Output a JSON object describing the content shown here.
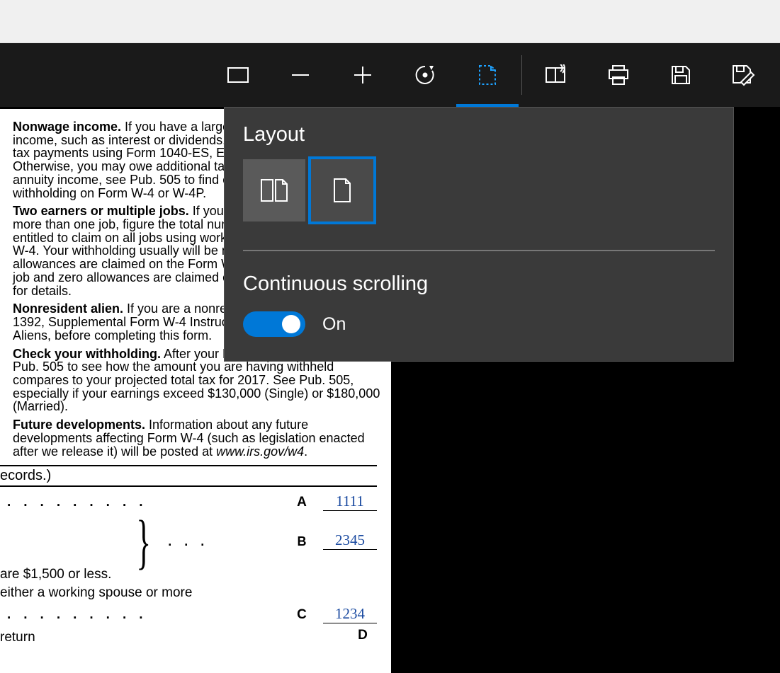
{
  "toolbar": {
    "icons": {
      "fit": "fit-width-icon",
      "zoom_out": "zoom-out-icon",
      "zoom_in": "zoom-in-icon",
      "rotate": "rotate-icon",
      "layout": "layout-icon",
      "read_aloud": "read-aloud-icon",
      "print": "print-icon",
      "save": "save-icon",
      "save_as": "save-as-icon"
    }
  },
  "layout_popup": {
    "title": "Layout",
    "options": {
      "two_page": "two-page-layout",
      "single_page": "single-page-layout",
      "selected": "single_page"
    },
    "continuous_title": "Continuous scrolling",
    "toggle_state": "On"
  },
  "document": {
    "paragraphs": {
      "nonwage": {
        "heading": "Nonwage income.",
        "body": " If you have a large amount of nonwage income, such as interest or dividends, consider making estimated tax payments using Form 1040-ES, Estimated Tax for Individuals. Otherwise, you may owe additional tax. If you have pension or annuity income, see Pub. 505 to find out if you should adjust your withholding on Form W-4 or W-4P."
      },
      "two_earners": {
        "heading": "Two earners or multiple jobs.",
        "body": " If you have a working spouse or more than one job, figure the total number of allowances you are entitled to claim on all jobs using worksheets from only one Form W-4. Your withholding usually will be most accurate when all allowances are claimed on the Form W-4 for the highest paying job and zero allowances are claimed on the others. See Pub. 505 for details."
      },
      "nonresident": {
        "heading": "Nonresident alien.",
        "body": " If you are a nonresident alien, see Notice 1392, Supplemental Form W-4 Instructions for Nonresident Aliens, before completing this form."
      },
      "check": {
        "heading": "Check your withholding.",
        "body": " After your Form W-4 takes effect, use Pub. 505 to see how the amount you are having withheld compares to your projected total tax for 2017. See Pub. 505, especially if your earnings exceed $130,000 (Single) or $180,000 (Married)."
      },
      "future": {
        "heading": "Future developments.",
        "body_pre": " Information about any future developments affecting Form W-4 (such as legislation enacted after we release it) will be posted at ",
        "url": "www.irs.gov/w4",
        "body_post": "."
      }
    },
    "worksheet_header": "ecords.)",
    "lines": {
      "less_text": " are $1,500 or less.",
      "spouse_text": "either a working spouse or more",
      "return_text": "return"
    },
    "rows": {
      "A": {
        "label": "A",
        "value": "1111"
      },
      "B": {
        "label": "B",
        "value": "2345"
      },
      "C": {
        "label": "C",
        "value": "1234"
      },
      "D": {
        "label": "D",
        "value": ""
      }
    }
  }
}
